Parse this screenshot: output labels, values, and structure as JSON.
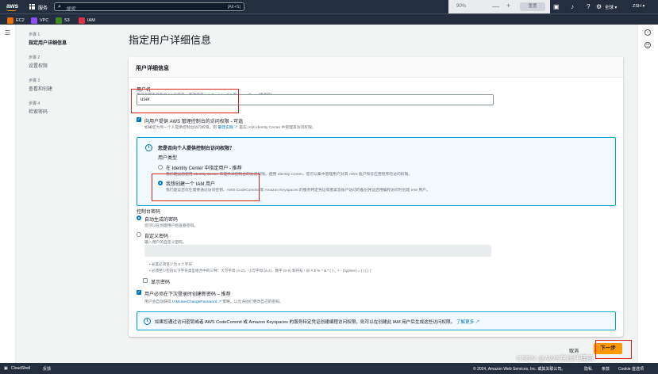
{
  "topbar": {
    "logo": "aws",
    "services": "服务",
    "search_placeholder": "搜索",
    "search_shortcut": "[Alt+S]",
    "zoom": "90%",
    "zoom_minus": "—",
    "zoom_plus": "+",
    "zoom_reset": "重置",
    "region": "全球 ▾",
    "user": "ZSH ▾"
  },
  "favorites": [
    {
      "label": "EC2",
      "color": "#ed7100"
    },
    {
      "label": "VPC",
      "color": "#8c4fff"
    },
    {
      "label": "S3",
      "color": "#3f8624"
    },
    {
      "label": "IAM",
      "color": "#dd344c"
    }
  ],
  "steps": [
    {
      "num": "步骤 1",
      "label": "指定用户详细信息"
    },
    {
      "num": "步骤 2",
      "label": "设置权限"
    },
    {
      "num": "步骤 3",
      "label": "查看和创建"
    },
    {
      "num": "步骤 4",
      "label": "检索密码"
    }
  ],
  "page_title": "指定用户详细信息",
  "card": {
    "title": "用户详细信息",
    "username_label": "用户名",
    "username_hint": "用户名最多可包含 64 个字符。有效字符：A-Z、a-z、0-9 和 + =, . @ _ - (连字符)",
    "username_value": "user",
    "console_access_label": "向用户提供 AWS 管理控制台的访问权限 - 可选",
    "console_access_sub_1": "如果您为另一个人提供控制台访问权限，则",
    "console_access_link": "最佳实践",
    "console_access_sub_2": "是在 IAM Identity Center 中管理其访问权限。",
    "info_question": "您是否向个人提供控制台访问权限？",
    "user_type_label": "用户类型",
    "opt1_label": "在 Identity Center 中指定用户 - 推荐",
    "opt1_sub": "我们建议您使用 Identity Center 来提供对控制台的访问权限。使用 Identity Center，您可以集中管理用户对其 AWS 账户和云应用程序的访问权限。",
    "opt2_label": "我想创建一个 IAM 用户",
    "opt2_sub": "我们建议您仅在需要通过访问密钥、AWS CodeCommit 或 Amazon Keyspaces 的服务特定凭证或者紧急账户访问的备份凭证启用编程访问时创建 IAM 用户。",
    "console_pw_label": "控制台密码",
    "autogen_label": "自动生成的密码",
    "autogen_sub": "您可以在创建用户后查看密码。",
    "custom_label": "自定义密码",
    "custom_sub": "输入用户的自定义密码。",
    "bullet1": "• 长度必须至少为 8 个字符",
    "bullet2": "• 必须至少包括以下字符类型组合中的三种：大写字母 (A-Z)、小写字母 (a-z)、数字 (0-9) 和符号 ! @ # $ % ^ & * ( ) _ + - (hyphen) = [ ] { } | '",
    "show_pw_label": "显示密码",
    "reset_pw_label": "用户必须在下次登录时创建新密码 – 推荐",
    "reset_pw_sub_1": "用户会自动获得",
    "reset_pw_link": "IAMUserChangePassword",
    "reset_pw_sub_2": "策略，以允许他们更改自己的密码。",
    "bottom_info": "如果您通过访问密钥或者 AWS CodeCommit 或 Amazon Keyspaces 的服务特定凭证创建编程访问权限，则可以在创建此 IAM 用户后生成这些访问权限。",
    "bottom_info_link": "了解更多"
  },
  "actions": {
    "cancel": "取消",
    "next": "下一步"
  },
  "footer": {
    "cloudshell": "CloudShell",
    "feedback": "反馈",
    "copyright": "© 2024, Amazon Web Services, Inc. 或其关联公司。",
    "privacy": "隐私",
    "terms": "条款",
    "cookie": "Cookie 首选项"
  },
  "watermark": "CSDN @AWS在线代理商"
}
